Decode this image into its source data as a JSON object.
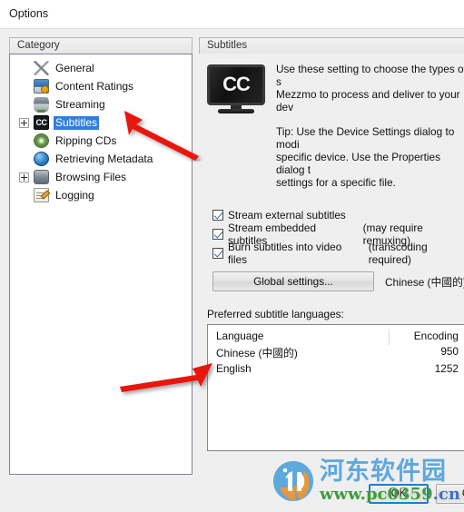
{
  "window": {
    "title": "Options"
  },
  "category_panel": {
    "header": "Category",
    "items": [
      {
        "label": "General",
        "icon": "wrench-screwdriver-icon",
        "expander": "none",
        "selected": false
      },
      {
        "label": "Content Ratings",
        "icon": "monitor-warning-icon",
        "expander": "none",
        "selected": false
      },
      {
        "label": "Streaming",
        "icon": "projector-icon",
        "expander": "none",
        "selected": false
      },
      {
        "label": "Subtitles",
        "icon": "cc-icon",
        "expander": "plus",
        "selected": true
      },
      {
        "label": "Ripping CDs",
        "icon": "disc-icon",
        "expander": "none",
        "selected": false
      },
      {
        "label": "Retrieving Metadata",
        "icon": "globe-icon",
        "expander": "none",
        "selected": false
      },
      {
        "label": "Browsing Files",
        "icon": "server-icon",
        "expander": "plus",
        "selected": false
      },
      {
        "label": "Logging",
        "icon": "notepad-pencil-icon",
        "expander": "none",
        "selected": false
      }
    ]
  },
  "settings_panel": {
    "header": "Subtitles",
    "icon": "cc-tv-icon",
    "icon_text": "CC",
    "description": {
      "paragraph1_line1": "Use these setting to choose the types of s",
      "paragraph1_line2": "Mezzmo to process and deliver to your dev",
      "paragraph2_line1": "Tip: Use the Device Settings dialog to modi",
      "paragraph2_line2": "specific device.  Use the Properties dialog t",
      "paragraph2_line3": "settings for a specific file."
    },
    "checkboxes": [
      {
        "label": "Stream external subtitles",
        "note": "",
        "checked": true
      },
      {
        "label": "Stream embedded subtitles",
        "note": "(may require remuxing)",
        "checked": true
      },
      {
        "label": "Burn subtitles into video files",
        "note": "(transcoding required)",
        "checked": true
      }
    ],
    "global_settings_button": "Global settings...",
    "global_settings_value": "Chinese (中國的), ",
    "preferred_label": "Preferred subtitle languages:",
    "table": {
      "columns": [
        "Language",
        "Encoding"
      ],
      "rows": [
        {
          "language": "Chinese (中國的)",
          "encoding": "950"
        },
        {
          "language": "English",
          "encoding": "1252"
        }
      ]
    }
  },
  "footer": {
    "ok_label": "OK",
    "cancel_label": "C"
  },
  "watermark": {
    "site_name": "河东软件园",
    "url_part1": "www.",
    "url_part2": "pc0359",
    "url_part3": ".cn",
    "logo": "hedong-circle-logo"
  },
  "annotations": {
    "arrow_1": "red-arrow-pointing-to-subtitles",
    "arrow_2": "red-arrow-pointing-to-language-table",
    "arrow_color": "#e8120c"
  },
  "colors": {
    "selection_blue": "#2f7fe0",
    "focus_blue": "#1a7fd4",
    "panel_bg": "#efefef"
  }
}
